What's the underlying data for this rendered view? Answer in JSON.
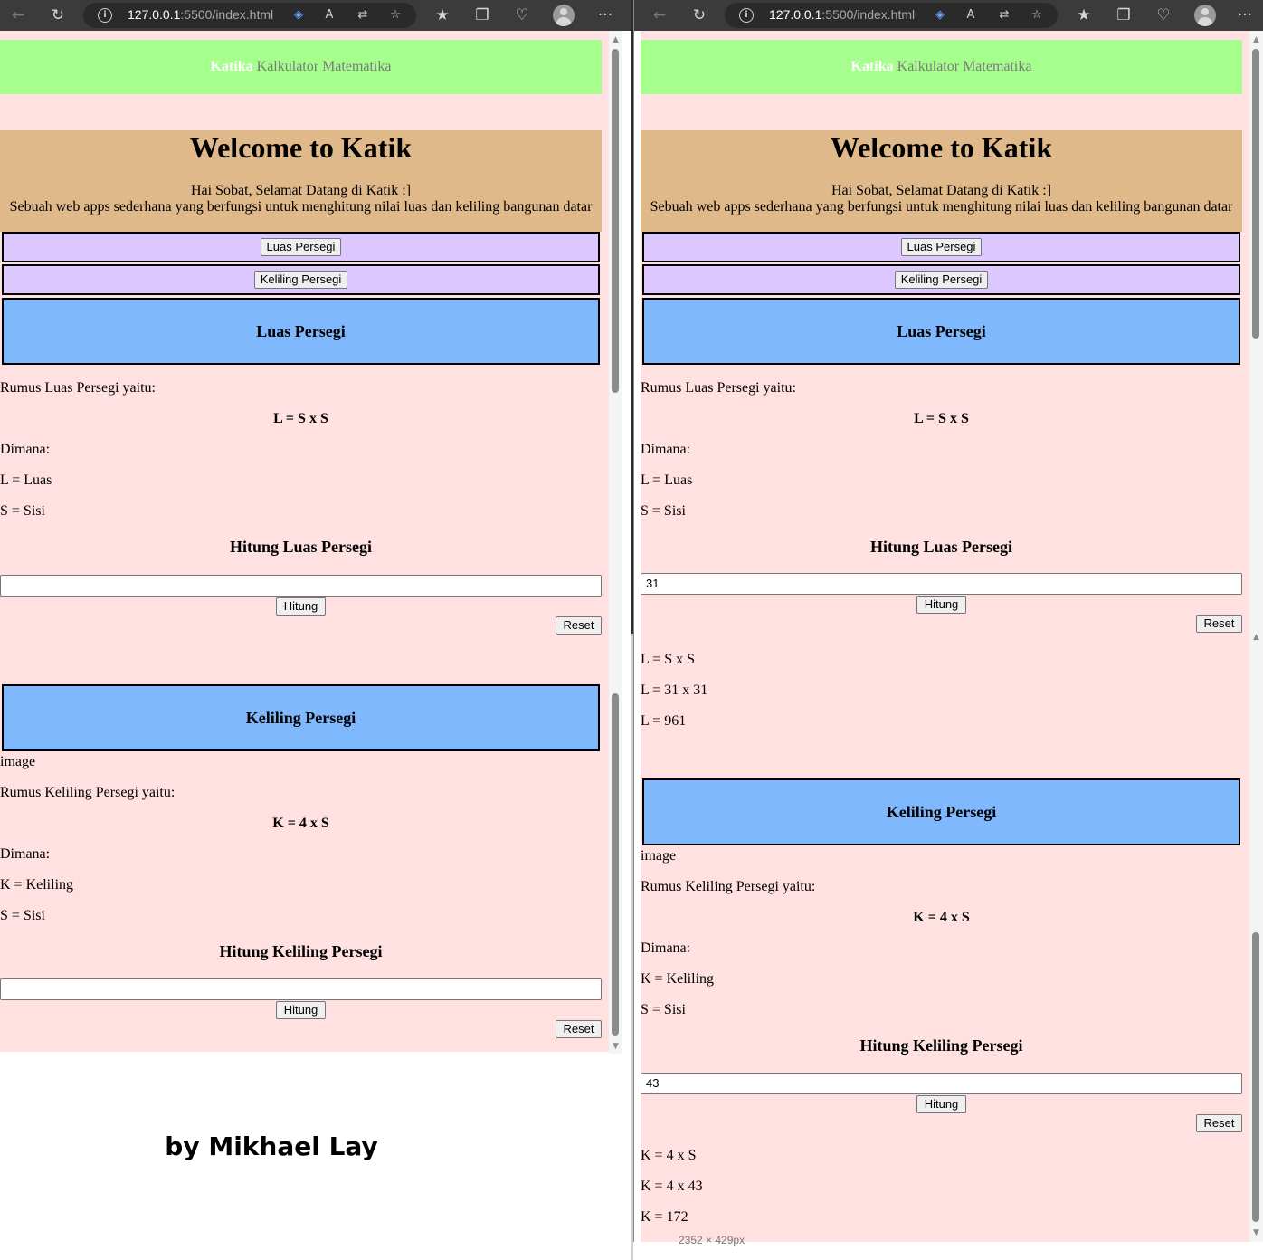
{
  "browser": {
    "url_host": "127.0.0.1",
    "url_path": ":5500/index.html",
    "icons": [
      "back-icon",
      "refresh-icon",
      "info-icon",
      "tag-icon",
      "read-aloud-icon",
      "translate-icon",
      "add-favorite-icon",
      "favorites-icon",
      "collections-icon",
      "browser-essentials-icon",
      "profile-icon",
      "more-icon"
    ],
    "info_glyph": "i",
    "more_glyph": "···"
  },
  "page": {
    "brand": "Katika",
    "brand_sub": "Kalkulator Matematika",
    "hero_title": "Welcome to Katik",
    "hero_line1": "Hai Sobat, Selamat Datang di Katik :]",
    "hero_line2": "Sebuah web apps sederhana yang berfungsi untuk menghitung nilai luas dan keliling bangunan datar",
    "tab_luas": "Luas Persegi",
    "tab_keliling": "Keliling Persegi",
    "luas": {
      "heading": "Luas Persegi",
      "rumus_label": "Rumus Luas Persegi yaitu:",
      "rumus": "L = S x S",
      "dimana": "Dimana:",
      "var1": "L = Luas",
      "var2": "S = Sisi",
      "calc_title": "Hitung Luas Persegi",
      "hitung": "Hitung",
      "reset": "Reset"
    },
    "keliling": {
      "heading": "Keliling Persegi",
      "image_alt": "image",
      "rumus_label": "Rumus Keliling Persegi yaitu:",
      "rumus": "K = 4 x S",
      "dimana": "Dimana:",
      "var1": "K = Keliling",
      "var2": "S = Sisi",
      "calc_title": "Hitung Keliling Persegi",
      "hitung": "Hitung",
      "reset": "Reset"
    }
  },
  "left_window": {
    "luas_input": "",
    "keliling_input": ""
  },
  "right_window": {
    "luas_input": "31",
    "luas_result": [
      "L = S x S",
      "L = 31 x 31",
      "L = 961"
    ],
    "keliling_input": "43",
    "keliling_result": [
      "K = 4 x S",
      "K = 4 x 43",
      "K = 172"
    ]
  },
  "footer_sign": "by Mikhael Lay",
  "ghost_text": "2352 × 429px",
  "colors": {
    "page_bg": "#ffe1e1",
    "navbar": "#a6fe8c",
    "hero": "#dfb98a",
    "tab": "#dcc8fe",
    "section_head": "#80b8fe"
  }
}
